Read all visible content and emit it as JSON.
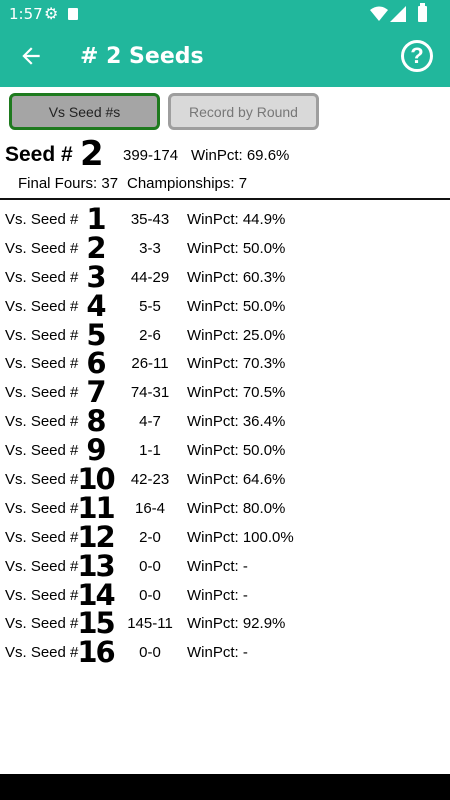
{
  "status": {
    "time": "1:57"
  },
  "appbar": {
    "title": "# 2 Seeds",
    "help_glyph": "?"
  },
  "tabs": {
    "vs_seeds": "Vs Seed #s",
    "record_by_round": "Record by Round"
  },
  "summary": {
    "seed_label": "Seed #",
    "seed_number": "2",
    "record": "399-174",
    "winpct": "WinPct: 69.6%",
    "final_fours": "Final Fours: 37",
    "championships": "Championships: 7"
  },
  "rows": [
    {
      "label": "Vs. Seed #",
      "seed": "1",
      "record": "35-43",
      "winpct": "WinPct: 44.9%"
    },
    {
      "label": "Vs. Seed #",
      "seed": "2",
      "record": "3-3",
      "winpct": "WinPct: 50.0%"
    },
    {
      "label": "Vs. Seed #",
      "seed": "3",
      "record": "44-29",
      "winpct": "WinPct: 60.3%"
    },
    {
      "label": "Vs. Seed #",
      "seed": "4",
      "record": "5-5",
      "winpct": "WinPct: 50.0%"
    },
    {
      "label": "Vs. Seed #",
      "seed": "5",
      "record": "2-6",
      "winpct": "WinPct: 25.0%"
    },
    {
      "label": "Vs. Seed #",
      "seed": "6",
      "record": "26-11",
      "winpct": "WinPct: 70.3%"
    },
    {
      "label": "Vs. Seed #",
      "seed": "7",
      "record": "74-31",
      "winpct": "WinPct: 70.5%"
    },
    {
      "label": "Vs. Seed #",
      "seed": "8",
      "record": "4-7",
      "winpct": "WinPct: 36.4%"
    },
    {
      "label": "Vs. Seed #",
      "seed": "9",
      "record": "1-1",
      "winpct": "WinPct: 50.0%"
    },
    {
      "label": "Vs. Seed #",
      "seed": "10",
      "record": "42-23",
      "winpct": "WinPct: 64.6%"
    },
    {
      "label": "Vs. Seed #",
      "seed": "11",
      "record": "16-4",
      "winpct": "WinPct: 80.0%"
    },
    {
      "label": "Vs. Seed #",
      "seed": "12",
      "record": "2-0",
      "winpct": "WinPct: 100.0%"
    },
    {
      "label": "Vs. Seed #",
      "seed": "13",
      "record": "0-0",
      "winpct": "WinPct: -"
    },
    {
      "label": "Vs. Seed #",
      "seed": "14",
      "record": "0-0",
      "winpct": "WinPct: -"
    },
    {
      "label": "Vs. Seed #",
      "seed": "15",
      "record": "145-11",
      "winpct": "WinPct: 92.9%"
    },
    {
      "label": "Vs. Seed #",
      "seed": "16",
      "record": "0-0",
      "winpct": "WinPct: -"
    }
  ]
}
